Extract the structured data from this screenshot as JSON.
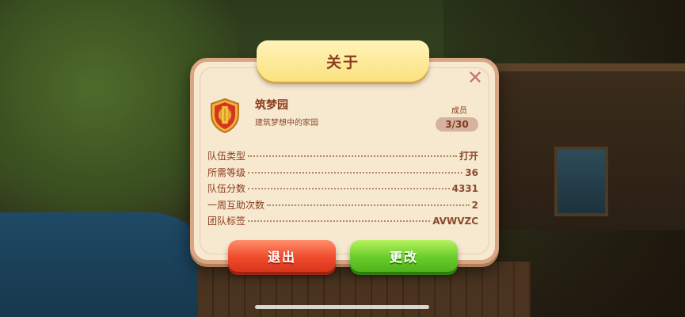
{
  "dialog": {
    "title": "关于",
    "close_icon": "close-icon",
    "emblem_icon": "lantern-shield-icon"
  },
  "team": {
    "name": "筑梦园",
    "description": "建筑梦想中的家园",
    "members_label": "成员",
    "members_count": "3/30"
  },
  "stats": [
    {
      "label": "队伍类型",
      "value": "打开"
    },
    {
      "label": "所需等级",
      "value": "36"
    },
    {
      "label": "队伍分数",
      "value": "4331"
    },
    {
      "label": "一周互助次数",
      "value": "2"
    },
    {
      "label": "团队标签",
      "value": "AVWVZC"
    }
  ],
  "buttons": {
    "exit": "退出",
    "change": "更改"
  },
  "colors": {
    "panel": "#f7e8d0",
    "title_banner": "#fbe27f",
    "text_brown": "#8a3d1e",
    "exit_red": "#ef4a2c",
    "change_green": "#68cc2a"
  }
}
